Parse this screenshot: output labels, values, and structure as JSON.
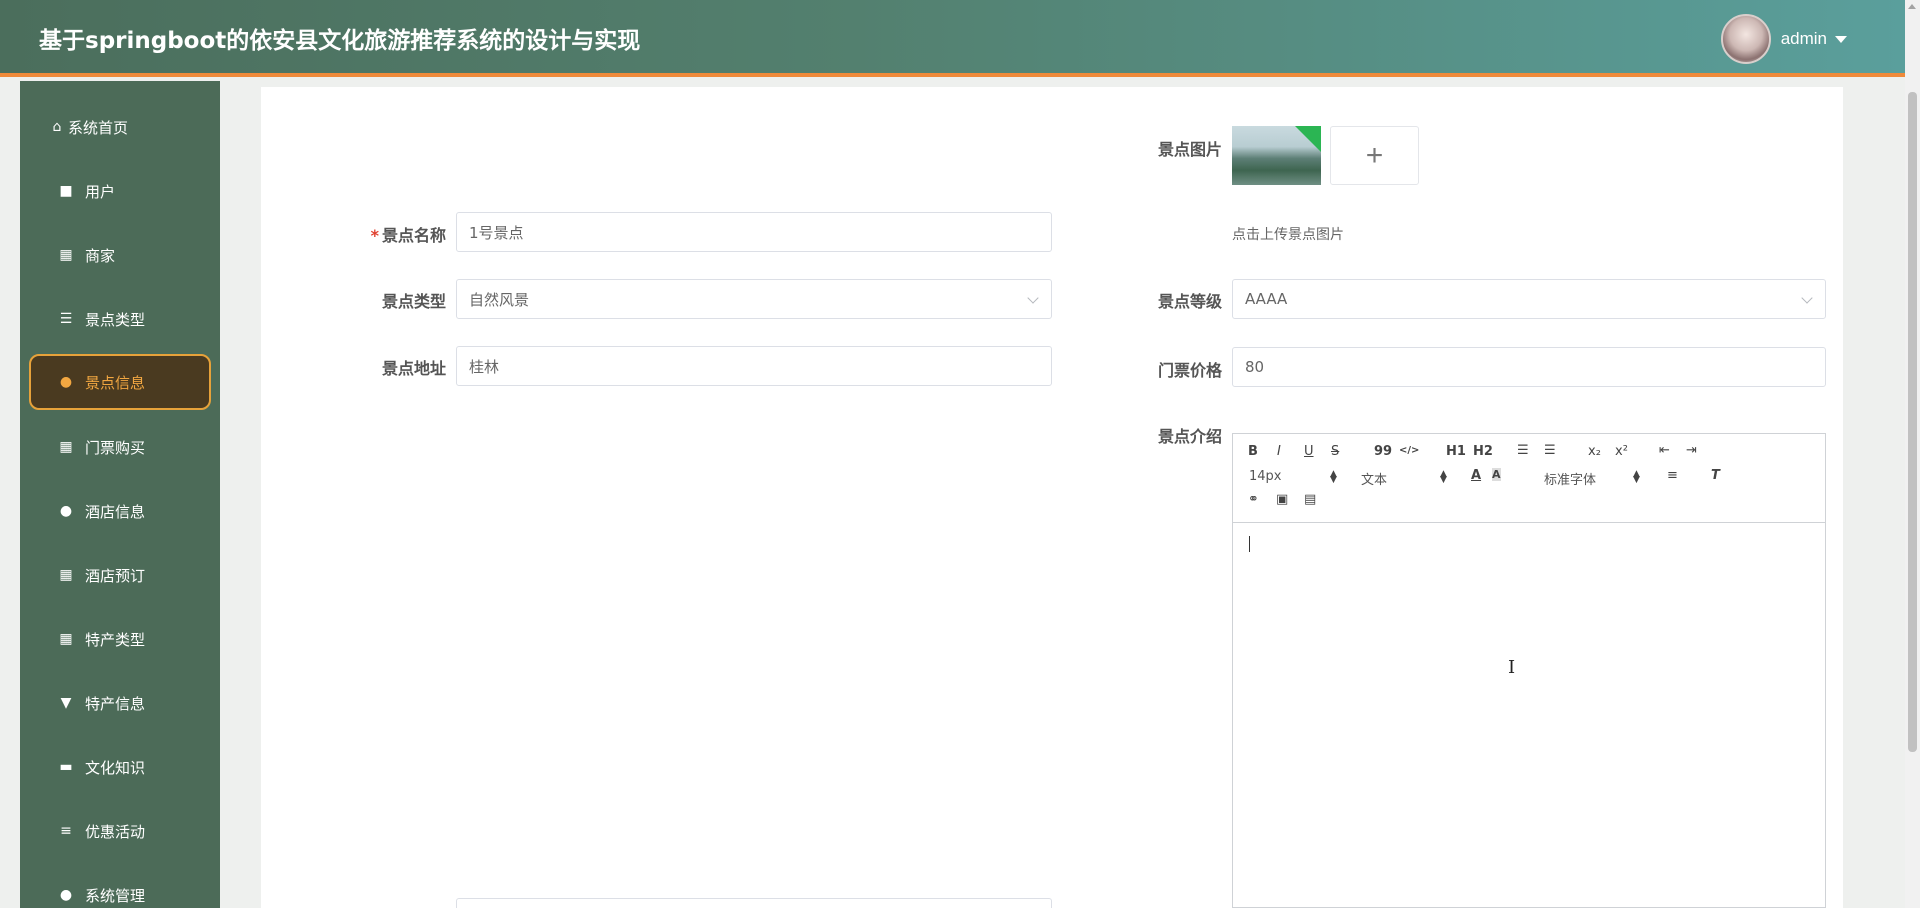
{
  "header": {
    "title": "基于springboot的依安县文化旅游推荐系统的设计与实现",
    "username": "admin"
  },
  "sidebar": {
    "items": [
      {
        "label": "系统首页",
        "icon": "home-icon"
      },
      {
        "label": "用户",
        "icon": "briefcase-icon"
      },
      {
        "label": "商家",
        "icon": "grid-icon"
      },
      {
        "label": "景点类型",
        "icon": "sliders-icon"
      },
      {
        "label": "景点信息",
        "icon": "user-icon",
        "active": true
      },
      {
        "label": "门票购买",
        "icon": "grid-icon"
      },
      {
        "label": "酒店信息",
        "icon": "bulb-icon"
      },
      {
        "label": "酒店预订",
        "icon": "grid-icon"
      },
      {
        "label": "特产类型",
        "icon": "grid-icon"
      },
      {
        "label": "特产信息",
        "icon": "stamp-icon"
      },
      {
        "label": "文化知识",
        "icon": "ticket-icon"
      },
      {
        "label": "优惠活动",
        "icon": "list-icon"
      },
      {
        "label": "系统管理",
        "icon": "user-icon"
      }
    ]
  },
  "form": {
    "picture": {
      "label": "景点图片",
      "hint": "点击上传景点图片",
      "add": "+"
    },
    "name": {
      "label": "景点名称",
      "required_mark": "*",
      "value": "1号景点"
    },
    "type": {
      "label": "景点类型",
      "value": "自然风景"
    },
    "level": {
      "label": "景点等级",
      "value": "AAAA"
    },
    "address": {
      "label": "景点地址",
      "value": "桂林"
    },
    "price": {
      "label": "门票价格",
      "value": "80"
    },
    "intro": {
      "label": "景点介绍"
    }
  },
  "editor": {
    "buttons": [
      "B",
      "I",
      "U",
      "S",
      "99",
      "</>",
      "H1",
      "H2",
      "ordered-list",
      "bullet-list",
      "x₂",
      "x²",
      "outdent",
      "indent",
      "font-color",
      "background-color",
      "align",
      "clear-format",
      "link",
      "image",
      "video"
    ],
    "size_select": "14px",
    "header_select": "文本",
    "font_select": "标准字体"
  },
  "colors": {
    "header_start": "#4b6e5c",
    "header_end": "#5a9f9c",
    "header_accent": "#ef8a3a",
    "sidebar": "#4c6b58",
    "active_text": "#f2a741"
  }
}
